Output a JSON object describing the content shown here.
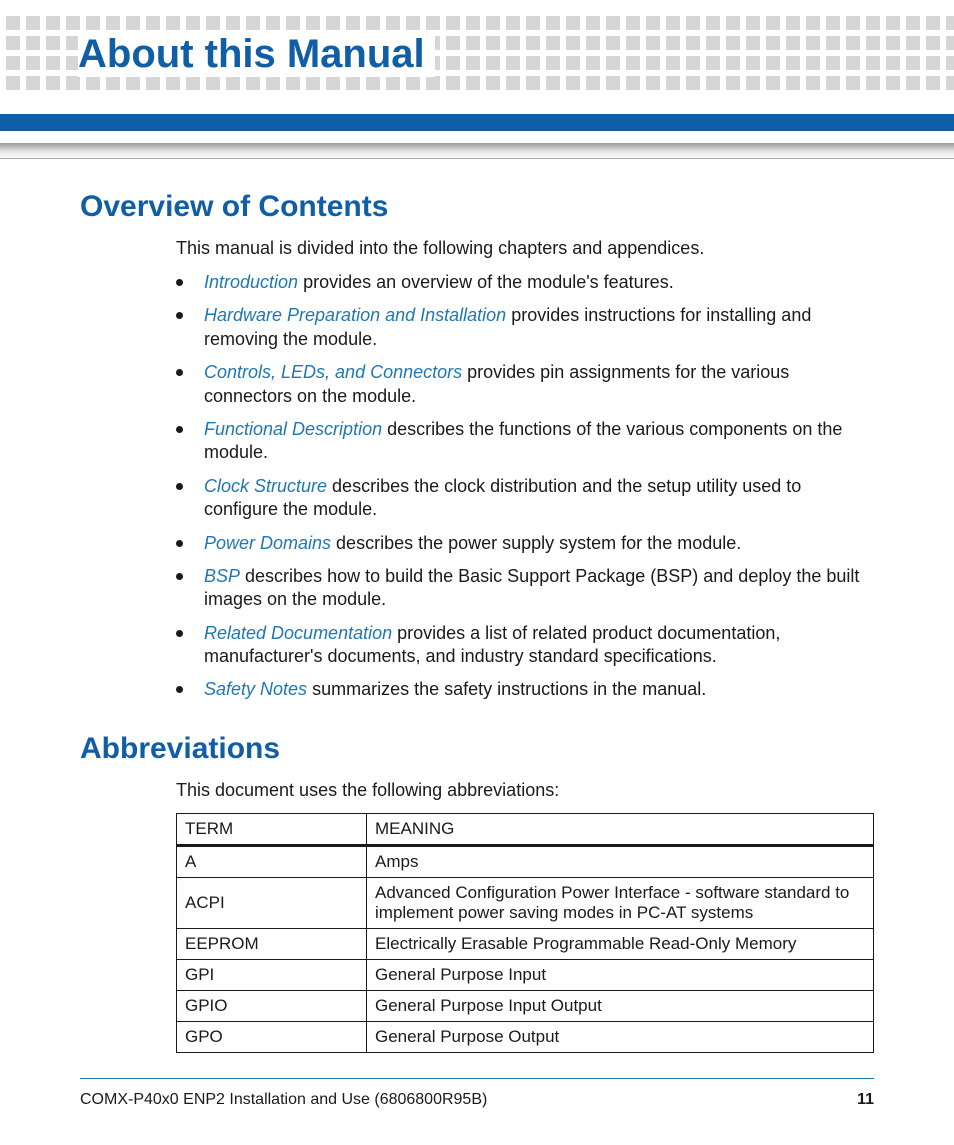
{
  "page_title": "About this Manual",
  "section1": {
    "heading": "Overview of Contents",
    "intro": "This manual is divided into the following chapters and appendices.",
    "items": [
      {
        "link": "Introduction",
        "rest": " provides an overview of the module's features."
      },
      {
        "link": "Hardware Preparation and Installation",
        "rest": " provides instructions for installing and removing the module."
      },
      {
        "link": "Controls, LEDs, and Connectors",
        "rest": " provides pin assignments for the various connectors on the module."
      },
      {
        "link": "Functional Description",
        "rest": " describes the functions of the various components on the module."
      },
      {
        "link": "Clock Structure",
        "rest": " describes the clock distribution and the setup utility used to configure the module."
      },
      {
        "link": "Power Domains",
        "rest": " describes the power supply system for the module."
      },
      {
        "link": "BSP",
        "rest": " describes how to build the Basic Support Package (BSP) and deploy the built images on the module."
      },
      {
        "link": "Related Documentation",
        "rest": " provides a list of related product documentation, manufacturer's documents, and industry standard specifications."
      },
      {
        "link": "Safety Notes",
        "rest": " summarizes the safety instructions in the manual."
      }
    ]
  },
  "section2": {
    "heading": "Abbreviations",
    "intro": "This document uses the following abbreviations:",
    "headers": {
      "c1": "TERM",
      "c2": "MEANING"
    },
    "rows": [
      {
        "term": "A",
        "meaning": "Amps"
      },
      {
        "term": "ACPI",
        "meaning": "Advanced Configuration Power Interface - software standard to implement power saving modes in PC-AT systems"
      },
      {
        "term": "EEPROM",
        "meaning": "Electrically Erasable Programmable Read-Only Memory"
      },
      {
        "term": "GPI",
        "meaning": "General Purpose Input"
      },
      {
        "term": "GPIO",
        "meaning": "General Purpose Input Output"
      },
      {
        "term": "GPO",
        "meaning": "General Purpose Output"
      }
    ]
  },
  "footer": {
    "doc": "COMX-P40x0 ENP2 Installation and Use (6806800R95B)",
    "page": "11"
  }
}
